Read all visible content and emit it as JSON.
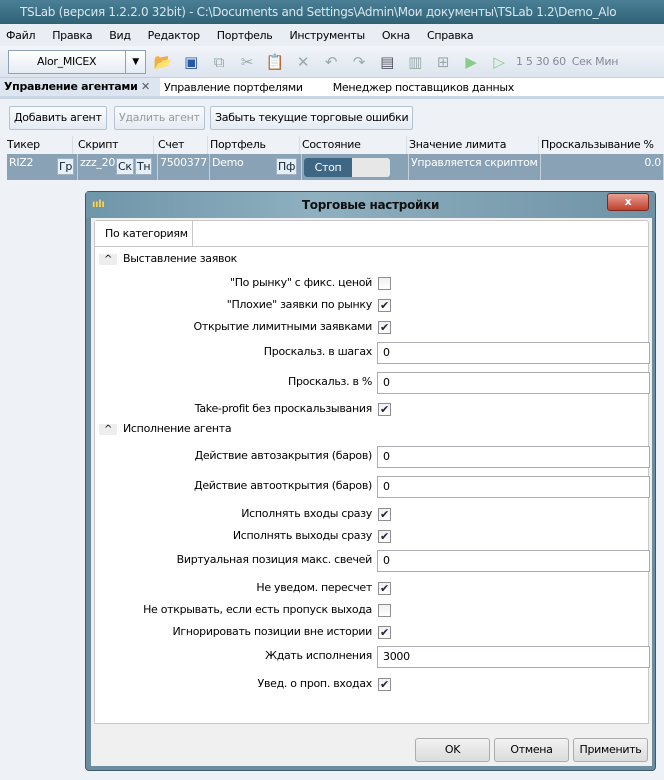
{
  "window": {
    "title": "TSLab (версия 1.2.2.0 32bit) - C:\\Documents and Settings\\Admin\\Мои документы\\TSLab 1.2\\Demo_Alo"
  },
  "menu": [
    "Файл",
    "Правка",
    "Вид",
    "Редактор",
    "Портфель",
    "Инструменты",
    "Окна",
    "Справка"
  ],
  "toolbar": {
    "provider": "Alor_MICEX",
    "intervals": "1  5  30  60",
    "units": "Сек  Мин"
  },
  "tabs": [
    {
      "label": "Управление агентами"
    },
    {
      "label": "Управление портфелями"
    },
    {
      "label": "Менеджер поставщиков данных"
    }
  ],
  "agents": {
    "add": "Добавить агент",
    "remove": "Удалить агент",
    "forget": "Забыть текущие торговые  ошибки",
    "columns": [
      "Тикер",
      "Скрипт",
      "Счет",
      "Портфель",
      "Состояние",
      "Значение лимита",
      "Проскальзывание %"
    ],
    "row": {
      "ticker": "RIZ2",
      "ticker_btn": "Гр",
      "script": "zzz_20",
      "script_btn1": "Ск",
      "script_btn2": "Тн",
      "account": "7500377",
      "portfolio": "Demo",
      "portfolio_btn": "Пф",
      "state": "Стоп",
      "limit": "Управляется скриптом",
      "slippage": "0.0"
    }
  },
  "dialog": {
    "title": "Торговые настройки",
    "close": "x",
    "tab": "По категориям",
    "sections": [
      {
        "title": "Выставление заявок",
        "rows": [
          {
            "label": "\"По рынку\" с фикс. ценой",
            "type": "check",
            "checked": false
          },
          {
            "label": "\"Плохие\" заявки по рынку",
            "type": "check",
            "checked": true
          },
          {
            "label": "Открытие лимитными заявками",
            "type": "check",
            "checked": true
          },
          {
            "label": "Проскальз. в шагах",
            "type": "input",
            "value": "0"
          },
          {
            "label": "Проскальз. в %",
            "type": "input",
            "value": "0"
          },
          {
            "label": "Take-profit без проскальзывания",
            "type": "check",
            "checked": true
          }
        ]
      },
      {
        "title": "Исполнение агента",
        "rows": [
          {
            "label": "Действие автозакрытия (баров)",
            "type": "input",
            "value": "0"
          },
          {
            "label": "Действие автооткрытия (баров)",
            "type": "input",
            "value": "0"
          },
          {
            "label": "Исполнять входы сразу",
            "type": "check",
            "checked": true
          },
          {
            "label": "Исполнять выходы сразу",
            "type": "check",
            "checked": true
          },
          {
            "label": "Виртуальная позиция макс. свечей",
            "type": "input",
            "value": "0"
          },
          {
            "label": "Не уведом. пересчет",
            "type": "check",
            "checked": true
          },
          {
            "label": "Не открывать, если есть пропуск выхода",
            "type": "check",
            "checked": false
          },
          {
            "label": "Игнорировать позиции вне истории",
            "type": "check",
            "checked": true
          },
          {
            "label": "Ждать исполнения",
            "type": "input",
            "value": "3000"
          },
          {
            "label": "Увед. о проп. входах",
            "type": "check",
            "checked": true
          }
        ]
      }
    ],
    "ok": "OK",
    "cancel": "Отмена",
    "apply": "Применить"
  }
}
